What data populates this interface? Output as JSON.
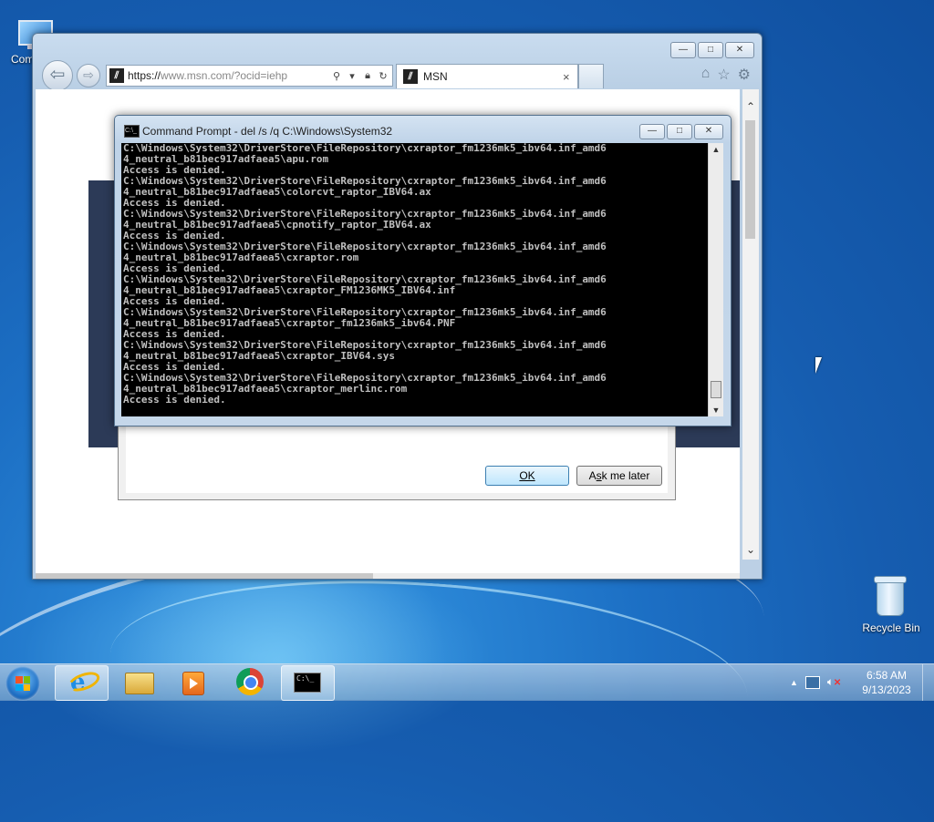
{
  "desktop": {
    "icons": [
      {
        "label": "Com"
      },
      {
        "label": "Recycle Bin"
      }
    ]
  },
  "browser": {
    "address": {
      "secure": "https://",
      "host": "www.msn.com",
      "path": "/?ocid=iehp"
    },
    "tab": {
      "title": "MSN",
      "close": "×"
    },
    "window_controls": {
      "minimize": "—",
      "maximize": "□",
      "close": "✕"
    },
    "toolbar_icons": [
      "home-icon",
      "star-icon",
      "gear-icon"
    ],
    "dialog": {
      "ok_label": "OK",
      "later_label_prefix": "A",
      "later_label_u": "s",
      "later_label_rest": "k me later"
    }
  },
  "cmd": {
    "title": "Command Prompt - del  /s /q C:\\Windows\\System32",
    "icon_text": "C:\\_",
    "lines": [
      "C:\\Windows\\System32\\DriverStore\\FileRepository\\cxraptor_fm1236mk5_ibv64.inf_amd6",
      "4_neutral_b81bec917adfaea5\\apu.rom",
      "Access is denied.",
      "C:\\Windows\\System32\\DriverStore\\FileRepository\\cxraptor_fm1236mk5_ibv64.inf_amd6",
      "4_neutral_b81bec917adfaea5\\colorcvt_raptor_IBV64.ax",
      "Access is denied.",
      "C:\\Windows\\System32\\DriverStore\\FileRepository\\cxraptor_fm1236mk5_ibv64.inf_amd6",
      "4_neutral_b81bec917adfaea5\\cpnotify_raptor_IBV64.ax",
      "Access is denied.",
      "C:\\Windows\\System32\\DriverStore\\FileRepository\\cxraptor_fm1236mk5_ibv64.inf_amd6",
      "4_neutral_b81bec917adfaea5\\cxraptor.rom",
      "Access is denied.",
      "C:\\Windows\\System32\\DriverStore\\FileRepository\\cxraptor_fm1236mk5_ibv64.inf_amd6",
      "4_neutral_b81bec917adfaea5\\cxraptor_FM1236MK5_IBV64.inf",
      "Access is denied.",
      "C:\\Windows\\System32\\DriverStore\\FileRepository\\cxraptor_fm1236mk5_ibv64.inf_amd6",
      "4_neutral_b81bec917adfaea5\\cxraptor_fm1236mk5_ibv64.PNF",
      "Access is denied.",
      "C:\\Windows\\System32\\DriverStore\\FileRepository\\cxraptor_fm1236mk5_ibv64.inf_amd6",
      "4_neutral_b81bec917adfaea5\\cxraptor_IBV64.sys",
      "Access is denied.",
      "C:\\Windows\\System32\\DriverStore\\FileRepository\\cxraptor_fm1236mk5_ibv64.inf_amd6",
      "4_neutral_b81bec917adfaea5\\cxraptor_merlinc.rom",
      "Access is denied."
    ]
  },
  "taskbar": {
    "time": "6:58 AM",
    "date": "9/13/2023",
    "tray_arrow": "▲",
    "apps": [
      "internet-explorer",
      "file-explorer",
      "media-player",
      "chrome",
      "command-prompt"
    ]
  }
}
